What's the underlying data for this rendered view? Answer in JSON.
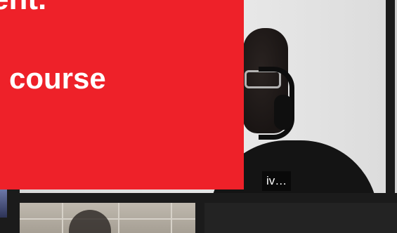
{
  "slide": {
    "line1": "ent.",
    "line2": "course"
  },
  "main_tile": {
    "participant_name": "iv…"
  },
  "colors": {
    "slide_red": "#ee2129",
    "app_background": "#1b1b1b",
    "name_tag_text": "#ffffff"
  }
}
